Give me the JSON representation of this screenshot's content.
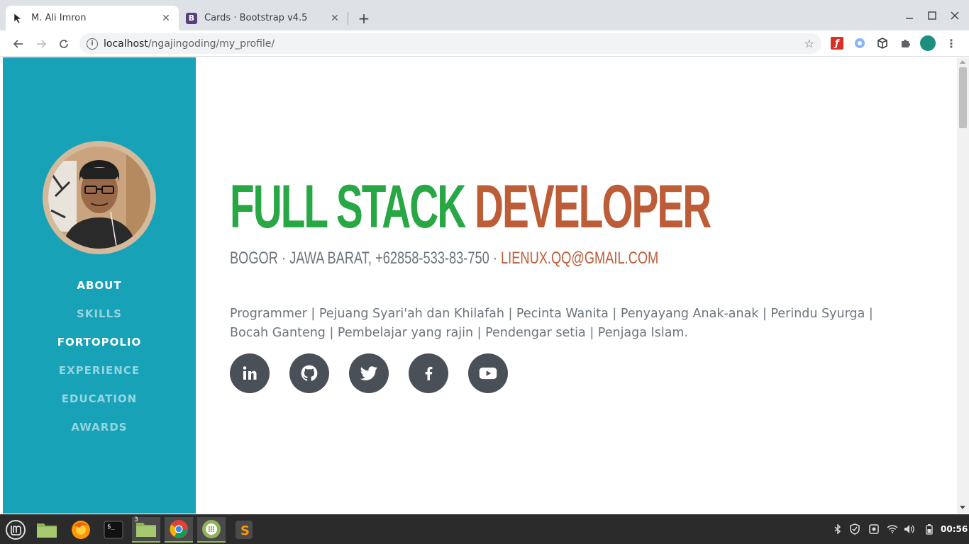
{
  "browser": {
    "tabs": [
      {
        "title": "M. Ali Imron",
        "active": true
      },
      {
        "title": "Cards · Bootstrap v4.5",
        "active": false,
        "favicon_letter": "B"
      }
    ],
    "url_host": "localhost",
    "url_path": "/ngajingoding/my_profile/"
  },
  "profile": {
    "name_first": "FULL STACK",
    "name_last": "DEVELOPER",
    "address": "Bogor · Jawa Barat, +62858-533-83-750 · ",
    "email": "lienux.qq@gmail.com",
    "lead": "Programmer | Pejuang Syari'ah dan Khilafah | Pecinta Wanita | Penyayang Anak-anak | Perindu Syurga | Bocah Ganteng | Pembelajar yang rajin | Pendengar setia | Penjaga Islam.",
    "social": [
      "linkedin",
      "github",
      "twitter",
      "facebook",
      "youtube"
    ]
  },
  "sidebar": {
    "items": [
      {
        "label": "About"
      },
      {
        "label": "Skills"
      },
      {
        "label": "Fortopolio"
      },
      {
        "label": "Experience"
      },
      {
        "label": "Education"
      },
      {
        "label": "Awards"
      }
    ]
  },
  "taskbar": {
    "folder_badge": "3",
    "clock": "00:56"
  },
  "colors": {
    "sidebar": "#17a2b8",
    "headline_first": "#28a745",
    "accent": "#bd5d38",
    "text": "#6c757d",
    "social_bg": "#495057"
  }
}
